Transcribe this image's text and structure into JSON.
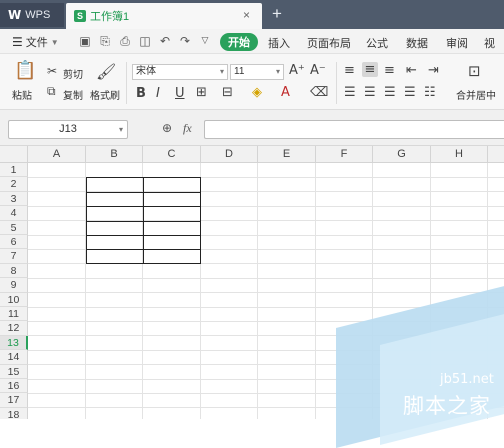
{
  "tabbar": {
    "home_tab": "WPS",
    "home_icon": "W",
    "doc_tab": "工作簿1",
    "doc_icon": "S",
    "close_glyph": "×",
    "add_glyph": "+"
  },
  "menubar": {
    "file_menu": "文件",
    "start_button": "开始",
    "tabs": [
      "插入",
      "页面布局",
      "公式",
      "数据",
      "审阅",
      "视图"
    ]
  },
  "ribbon": {
    "paste": "粘贴",
    "cut": "剪切",
    "copy": "复制",
    "format_painter": "格式刷",
    "font_name": "宋体",
    "font_size": "11",
    "merge_center": "合并居中"
  },
  "formulabar": {
    "cell_ref": "J13",
    "fx_label": "fx",
    "formula_value": ""
  },
  "grid": {
    "columns": [
      "A",
      "B",
      "C",
      "D",
      "E",
      "F",
      "G",
      "H"
    ],
    "rows": [
      "1",
      "2",
      "3",
      "4",
      "5",
      "6",
      "7",
      "8",
      "9",
      "10",
      "11",
      "12",
      "13",
      "14",
      "15",
      "16",
      "17",
      "18"
    ],
    "active_row": "13"
  },
  "watermark": {
    "site": "jb51.net",
    "name": "脚本之家"
  }
}
